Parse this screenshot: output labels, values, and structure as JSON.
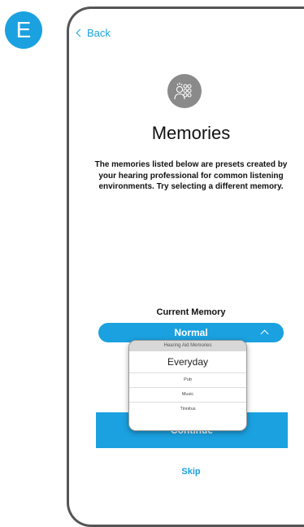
{
  "step_badge": "E",
  "nav": {
    "back_label": "Back"
  },
  "page": {
    "title": "Memories",
    "description": "The memories listed below are presets created by your hearing professional for common listening environments. Try selecting a different memory.",
    "current_memory_label": "Current Memory",
    "current_memory_value": "Normal",
    "continue_label": "Continue",
    "skip_label": "Skip"
  },
  "picker": {
    "header": "Hearing Aid Memories",
    "options": [
      "Everyday",
      "Pub",
      "Music",
      "Tinnitus"
    ],
    "selected_index": 0
  },
  "colors": {
    "accent": "#1ba1e0",
    "icon_background": "#8a8a8a"
  },
  "icons": {
    "back": "chevron-left-icon",
    "memories": "people-group-icon",
    "select": "chevron-up-icon"
  }
}
